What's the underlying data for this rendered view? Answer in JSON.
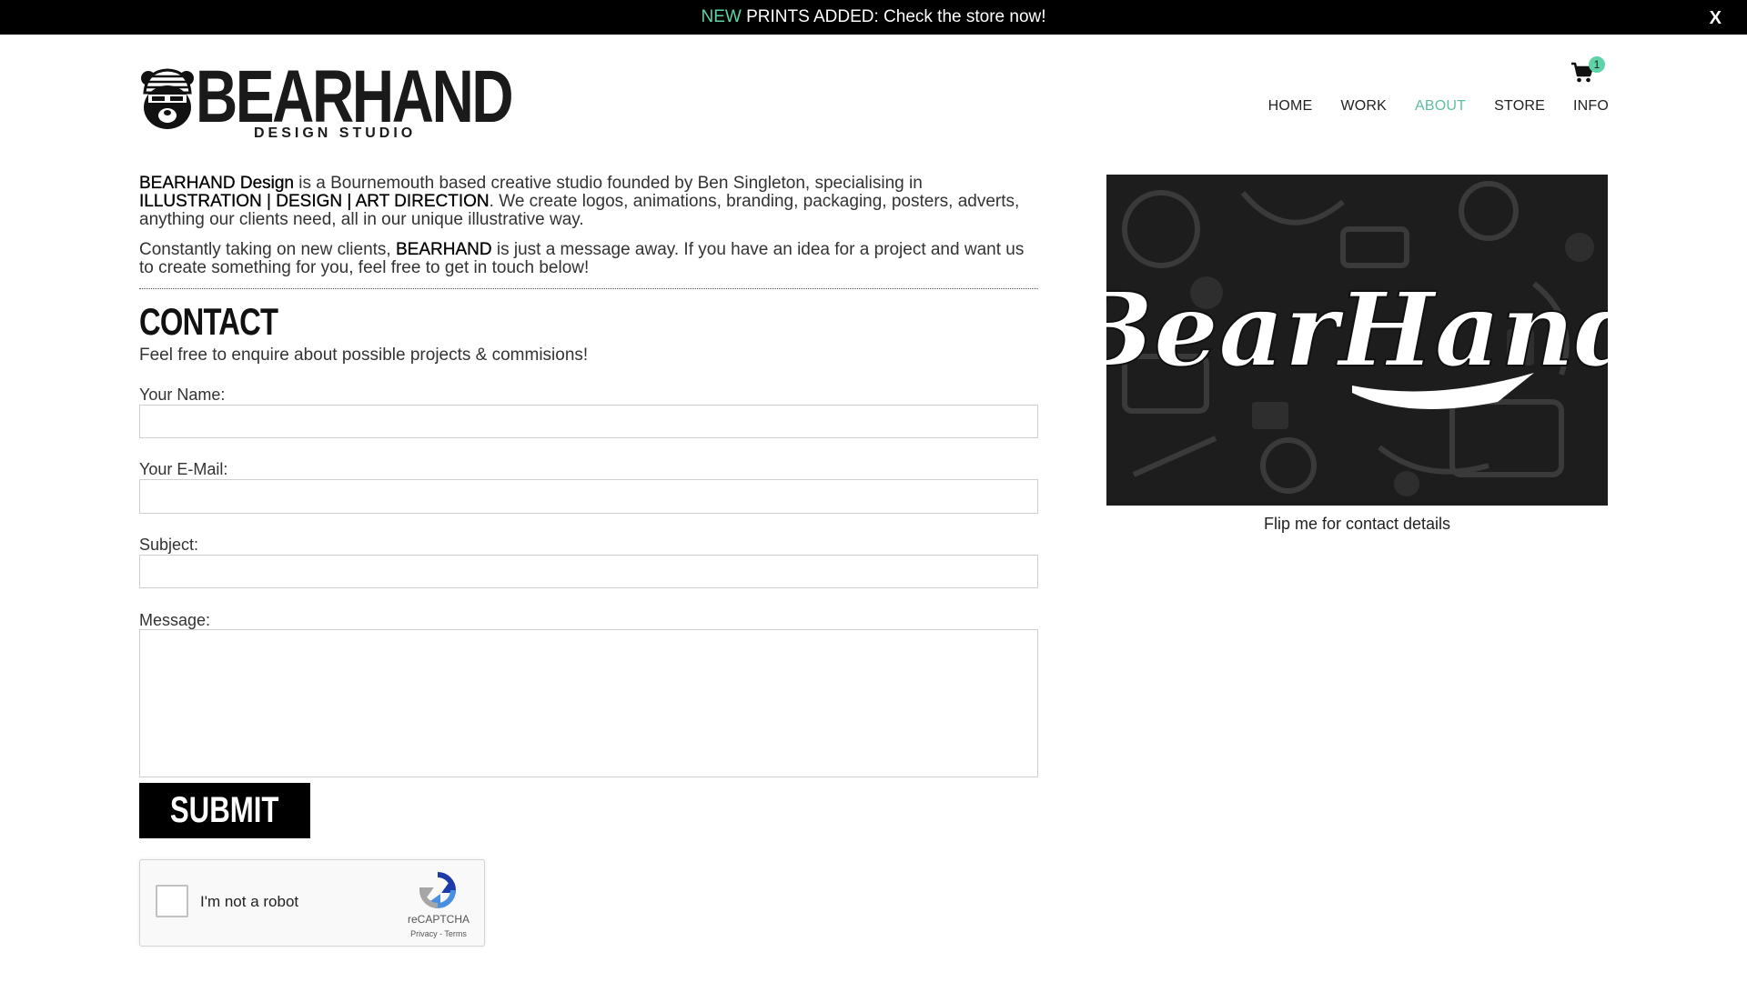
{
  "announcement": {
    "new_label": "NEW",
    "text": " PRINTS ADDED: Check the store now!",
    "close_label": "X"
  },
  "logo": {
    "wordmark": "BEARHAND",
    "tagline": "DESIGN STUDIO"
  },
  "cart": {
    "count": "1"
  },
  "nav": {
    "items": [
      {
        "label": "HOME"
      },
      {
        "label": "WORK"
      },
      {
        "label": "ABOUT"
      },
      {
        "label": "STORE"
      },
      {
        "label": "INFO"
      }
    ],
    "active": "ABOUT"
  },
  "intro": {
    "p1_brand": "BEARHAND Design",
    "p1_text1": " is a Bournemouth based creative studio founded by Ben Singleton, specialising in ",
    "p1_services": "ILLUSTRATION | DESIGN | ART DIRECTION",
    "p1_text2": ". We create logos, animations, branding, packaging, posters, adverts, anything our clients need, all in our unique illustrative way.",
    "p2_text1": "Constantly taking on new clients, ",
    "p2_brand": "BEARHAND",
    "p2_text2": " is just a message away. If you have an idea for a project and want us to create something for you, feel free to get in touch below!"
  },
  "contact": {
    "title": "CONTACT",
    "subtitle": "Feel free to enquire about possible projects & commisions!",
    "fields": [
      {
        "label": "Your Name:",
        "value": "",
        "placeholder": ""
      },
      {
        "label": "Your E-Mail:",
        "value": "",
        "placeholder": ""
      },
      {
        "label": "Subject:",
        "value": "",
        "placeholder": ""
      },
      {
        "label": "Message:",
        "value": "",
        "placeholder": ""
      }
    ],
    "submit_label": "SUBMIT"
  },
  "captcha": {
    "label": "I'm not a robot",
    "brand": "reCAPTCHA",
    "links": "Privacy - Terms"
  },
  "card": {
    "script_text": "BearHand",
    "caption": "Flip me for contact details"
  },
  "colors": {
    "accent": "#5fd3a8",
    "nav_active": "#5fbf9f",
    "announce_bg": "#000000"
  }
}
